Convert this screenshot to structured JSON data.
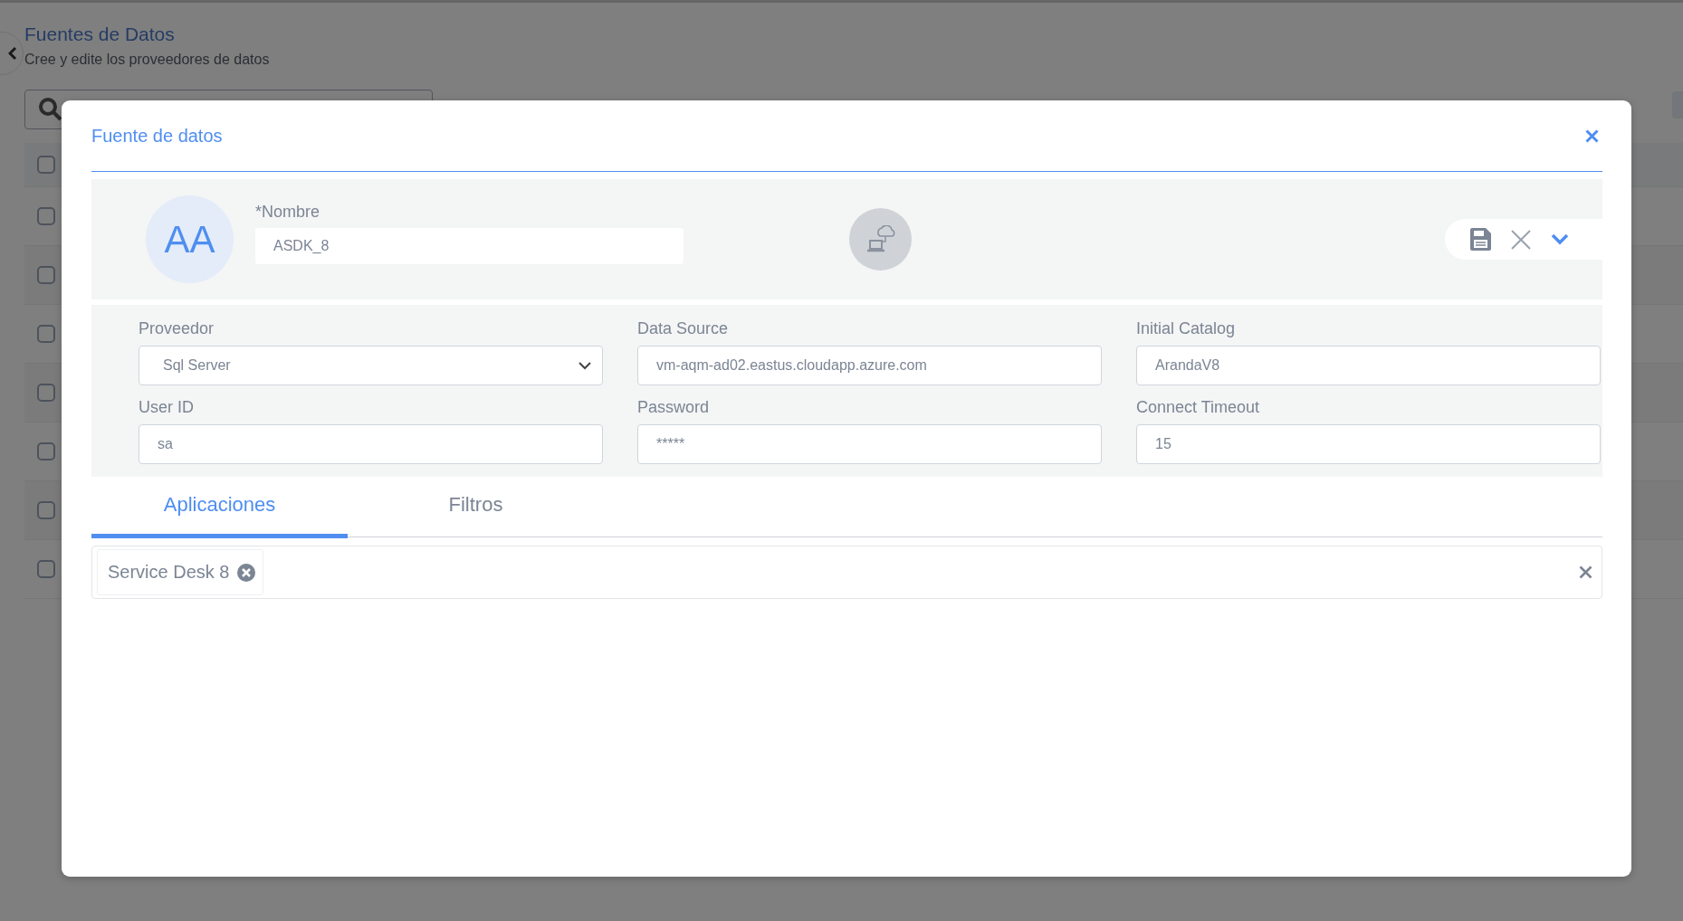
{
  "page": {
    "title": "Fuentes de Datos",
    "subtitle": "Cree y edite los proveedores de datos",
    "table": {
      "header": {
        "checked": false
      },
      "rows": [
        {
          "checked": false
        },
        {
          "checked": false
        },
        {
          "checked": false
        },
        {
          "checked": false
        },
        {
          "checked": false
        },
        {
          "checked": false
        },
        {
          "checked": false
        }
      ]
    }
  },
  "dialog": {
    "title": "Fuente de datos",
    "avatar": "AA",
    "name_field": {
      "label": "*Nombre",
      "value": "ASDK_8"
    },
    "fields": [
      {
        "kind": "select",
        "label": "Proveedor",
        "value": "Sql Server"
      },
      {
        "kind": "text",
        "label": "Data Source",
        "value": "vm-aqm-ad02.eastus.cloudapp.azure.com"
      },
      {
        "kind": "text",
        "label": "Initial Catalog",
        "value": "ArandaV8"
      },
      {
        "kind": "text",
        "label": "User ID",
        "value": "sa"
      },
      {
        "kind": "text",
        "label": "Password",
        "value": "*****"
      },
      {
        "kind": "text",
        "label": "Connect Timeout",
        "value": "15"
      }
    ],
    "tabs": [
      {
        "label": "Aplicaciones",
        "selected": true
      },
      {
        "label": "Filtros",
        "selected": false
      }
    ],
    "chips": [
      {
        "label": "Service Desk 8"
      }
    ]
  }
}
